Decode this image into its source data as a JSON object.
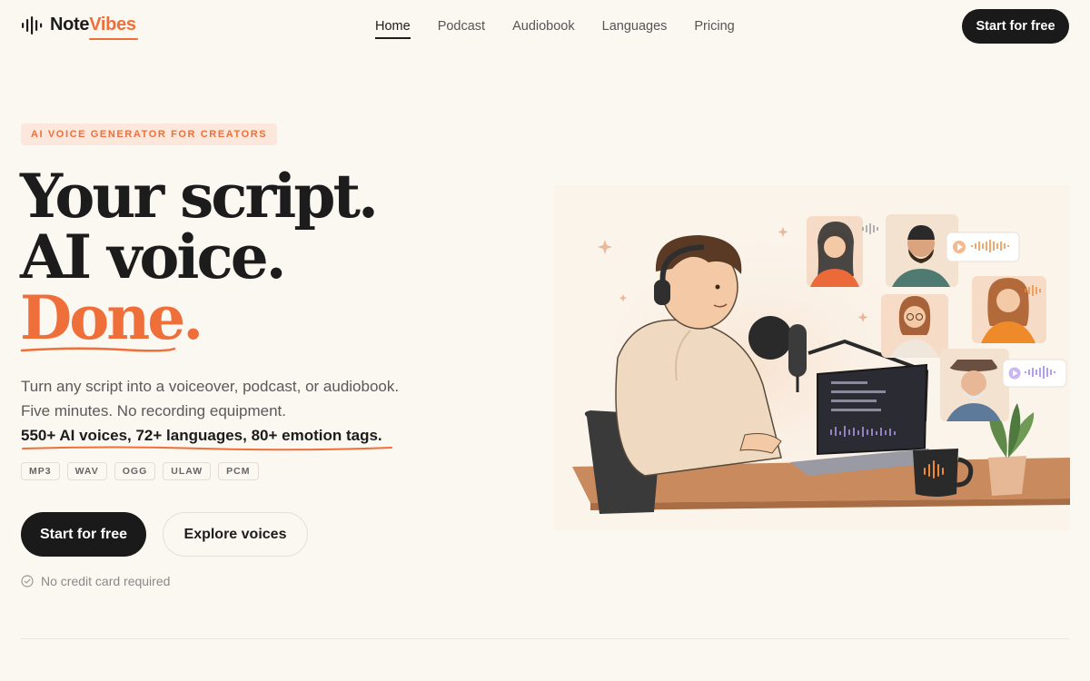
{
  "brand": {
    "name_part1": "Note",
    "name_part2": "Vibes",
    "logo_icon": "sound-wave-icon"
  },
  "nav": {
    "items": [
      {
        "label": "Home",
        "active": true
      },
      {
        "label": "Podcast",
        "active": false
      },
      {
        "label": "Audiobook",
        "active": false
      },
      {
        "label": "Languages",
        "active": false
      },
      {
        "label": "Pricing",
        "active": false
      }
    ],
    "cta": "Start for free"
  },
  "hero": {
    "eyebrow": "AI VOICE GENERATOR FOR CREATORS",
    "headline": {
      "line1": "Your script.",
      "line2": "AI voice.",
      "line3": "Done."
    },
    "subtext": "Turn any script into a voiceover, podcast, or audiobook. Five minutes. No recording equipment.",
    "highlight": "550+ AI voices, 72+ languages, 80+ emotion tags.",
    "formats": [
      "MP3",
      "WAV",
      "OGG",
      "ULAW",
      "PCM"
    ],
    "primary_cta": "Start for free",
    "secondary_cta": "Explore voices",
    "note": "No credit card required"
  },
  "colors": {
    "accent": "#ef6f3a",
    "dark": "#1a1a1a",
    "background": "#fbf7f1",
    "purple": "#9b7fe0"
  }
}
